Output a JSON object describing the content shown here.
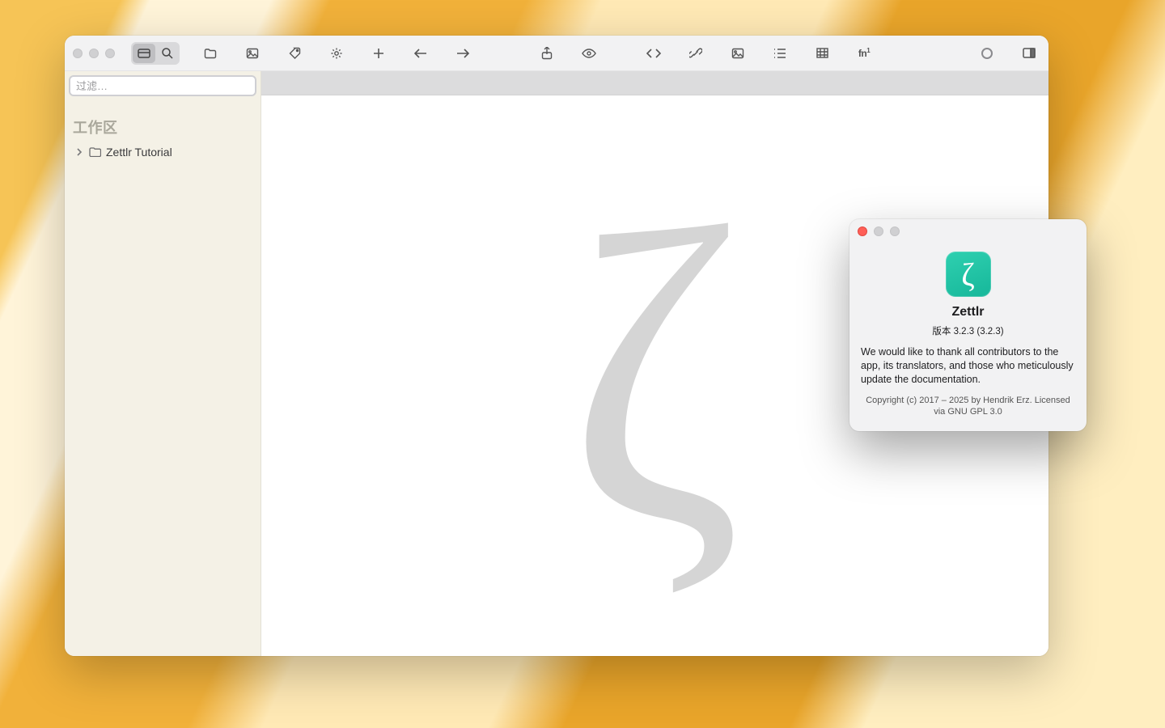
{
  "sidebar": {
    "filter_placeholder": "过滤…",
    "section_label": "工作区",
    "items": [
      {
        "label": "Zettlr Tutorial"
      }
    ]
  },
  "toolbar": {
    "icons": {
      "file_tree": "file-tree-icon",
      "search": "search-icon",
      "open": "folder-open-icon",
      "stats": "image-icon",
      "tags": "tag-icon",
      "settings": "gear-icon",
      "new": "plus-icon",
      "back": "arrow-left-icon",
      "forward": "arrow-right-icon",
      "export": "share-icon",
      "preview": "eye-icon",
      "code": "code-icon",
      "link": "link-icon",
      "image": "picture-icon",
      "tasklist": "list-icon",
      "table": "table-icon",
      "footnote": "footnote-icon",
      "pomodoro": "circle-icon",
      "panel": "panel-right-icon"
    }
  },
  "watermark_glyph": "ζ",
  "about": {
    "app_name": "Zettlr",
    "icon_glyph": "ζ",
    "version_line": "版本 3.2.3 (3.2.3)",
    "thanks": "We would like to thank all contributors to the app, its translators, and those who meticulously update the documentation.",
    "copyright": "Copyright (c) 2017 – 2025 by Hendrik Erz. Licensed via GNU GPL 3.0"
  }
}
